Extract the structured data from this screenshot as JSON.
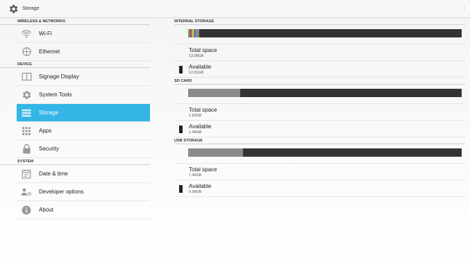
{
  "topbar": {
    "title": "Storage",
    "icon": "gear-icon"
  },
  "sidebar": {
    "sections": [
      {
        "header": "WIRELESS & NETWORKS",
        "items": [
          {
            "label": "Wi-Fi",
            "icon": "wifi-icon",
            "selected": false
          },
          {
            "label": "Ethernet",
            "icon": "ethernet-icon",
            "selected": false
          }
        ]
      },
      {
        "header": "DEVICE",
        "items": [
          {
            "label": "Signage Display",
            "icon": "display-icon",
            "selected": false
          },
          {
            "label": "System Tools",
            "icon": "gear-icon",
            "selected": false
          },
          {
            "label": "Storage",
            "icon": "storage-icon",
            "selected": true
          },
          {
            "label": "Apps",
            "icon": "apps-grid-icon",
            "selected": false
          },
          {
            "label": "Security",
            "icon": "lock-icon",
            "selected": false
          }
        ]
      },
      {
        "header": "SYSTEM",
        "items": [
          {
            "label": "Date & time",
            "icon": "calendar-icon",
            "selected": false
          },
          {
            "label": "Developer options",
            "icon": "developer-icon",
            "selected": false
          },
          {
            "label": "About",
            "icon": "info-icon",
            "selected": false
          }
        ]
      }
    ]
  },
  "storage": {
    "internal": {
      "header": "INTERNAL STORAGE",
      "total_label": "Total space",
      "total_value": "13.08GB",
      "available_label": "Available",
      "available_value": "12.81GB",
      "used_fraction": 0.04
    },
    "sd_card": {
      "header": "SD CARD",
      "total_label": "Total space",
      "total_value": "1.83GB",
      "available_label": "Available",
      "available_value": "1.48GB",
      "used_fraction": 0.19
    },
    "usb": {
      "header": "USB STORAGE",
      "total_label": "Total space",
      "total_value": "7.48GB",
      "available_label": "Available",
      "available_value": "5.98GB",
      "used_fraction": 0.2
    }
  },
  "colors": {
    "accent": "#33b5e5",
    "bar_available": "#333333",
    "bar_used": "#8a8a8a",
    "icon_gray": "#9a9a9a"
  }
}
